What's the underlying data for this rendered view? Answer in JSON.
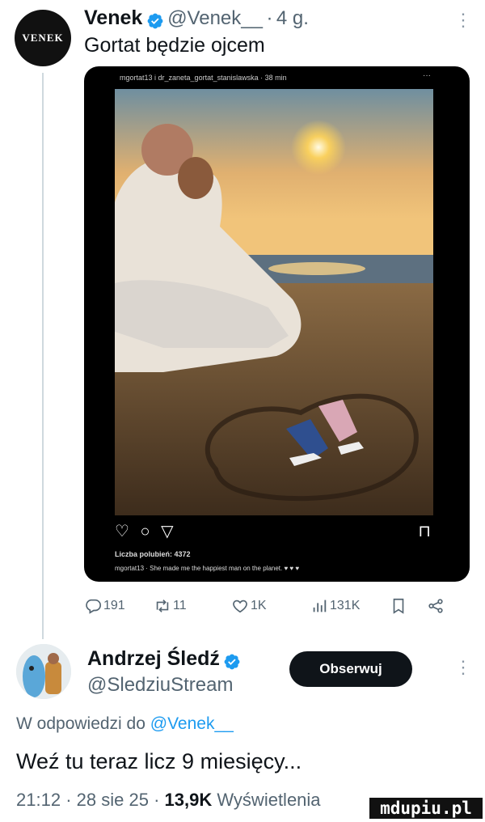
{
  "tweet1": {
    "avatar_text": "VENEK",
    "name": "Venek",
    "handle": "@Venek__",
    "time_sep": "·",
    "time": "4 g.",
    "more": "⋮",
    "text": "Gortat będzie ojcem",
    "media": {
      "ig_header": "mgortat13 i dr_zaneta_gortat_stanislawska · 38 min",
      "ig_menu": "···",
      "ig_likes": "Liczba polubień: 4372",
      "ig_caption": "mgortat13 · She made me the happiest man on the planet. ♥ ♥ ♥"
    },
    "actions": {
      "replies": "191",
      "retweets": "11",
      "likes": "1K",
      "views": "131K"
    }
  },
  "tweet2": {
    "name": "Andrzej Śledź",
    "handle": "@SledziuStream",
    "follow_label": "Obserwuj",
    "more": "⋮",
    "reply_prefix": "W odpowiedzi do",
    "reply_handle": "@Venek__",
    "text": "Weź tu teraz licz 9 miesięcy...",
    "time": "21:12",
    "sep1": "·",
    "date": "28 sie 25",
    "sep2": "·",
    "views": "13,9K",
    "views_label": "Wyświetlenia"
  },
  "watermark": "mdupiu.pl",
  "colors": {
    "accent": "#1d9bf0",
    "text": "#0f1419",
    "muted": "#536471"
  }
}
